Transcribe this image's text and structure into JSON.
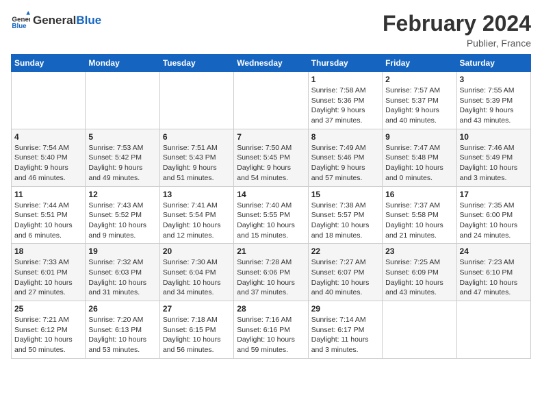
{
  "header": {
    "logo_general": "General",
    "logo_blue": "Blue",
    "month_title": "February 2024",
    "location": "Publier, France"
  },
  "days_of_week": [
    "Sunday",
    "Monday",
    "Tuesday",
    "Wednesday",
    "Thursday",
    "Friday",
    "Saturday"
  ],
  "weeks": [
    [
      {
        "day": "",
        "detail": ""
      },
      {
        "day": "",
        "detail": ""
      },
      {
        "day": "",
        "detail": ""
      },
      {
        "day": "",
        "detail": ""
      },
      {
        "day": "1",
        "detail": "Sunrise: 7:58 AM\nSunset: 5:36 PM\nDaylight: 9 hours\nand 37 minutes."
      },
      {
        "day": "2",
        "detail": "Sunrise: 7:57 AM\nSunset: 5:37 PM\nDaylight: 9 hours\nand 40 minutes."
      },
      {
        "day": "3",
        "detail": "Sunrise: 7:55 AM\nSunset: 5:39 PM\nDaylight: 9 hours\nand 43 minutes."
      }
    ],
    [
      {
        "day": "4",
        "detail": "Sunrise: 7:54 AM\nSunset: 5:40 PM\nDaylight: 9 hours\nand 46 minutes."
      },
      {
        "day": "5",
        "detail": "Sunrise: 7:53 AM\nSunset: 5:42 PM\nDaylight: 9 hours\nand 49 minutes."
      },
      {
        "day": "6",
        "detail": "Sunrise: 7:51 AM\nSunset: 5:43 PM\nDaylight: 9 hours\nand 51 minutes."
      },
      {
        "day": "7",
        "detail": "Sunrise: 7:50 AM\nSunset: 5:45 PM\nDaylight: 9 hours\nand 54 minutes."
      },
      {
        "day": "8",
        "detail": "Sunrise: 7:49 AM\nSunset: 5:46 PM\nDaylight: 9 hours\nand 57 minutes."
      },
      {
        "day": "9",
        "detail": "Sunrise: 7:47 AM\nSunset: 5:48 PM\nDaylight: 10 hours\nand 0 minutes."
      },
      {
        "day": "10",
        "detail": "Sunrise: 7:46 AM\nSunset: 5:49 PM\nDaylight: 10 hours\nand 3 minutes."
      }
    ],
    [
      {
        "day": "11",
        "detail": "Sunrise: 7:44 AM\nSunset: 5:51 PM\nDaylight: 10 hours\nand 6 minutes."
      },
      {
        "day": "12",
        "detail": "Sunrise: 7:43 AM\nSunset: 5:52 PM\nDaylight: 10 hours\nand 9 minutes."
      },
      {
        "day": "13",
        "detail": "Sunrise: 7:41 AM\nSunset: 5:54 PM\nDaylight: 10 hours\nand 12 minutes."
      },
      {
        "day": "14",
        "detail": "Sunrise: 7:40 AM\nSunset: 5:55 PM\nDaylight: 10 hours\nand 15 minutes."
      },
      {
        "day": "15",
        "detail": "Sunrise: 7:38 AM\nSunset: 5:57 PM\nDaylight: 10 hours\nand 18 minutes."
      },
      {
        "day": "16",
        "detail": "Sunrise: 7:37 AM\nSunset: 5:58 PM\nDaylight: 10 hours\nand 21 minutes."
      },
      {
        "day": "17",
        "detail": "Sunrise: 7:35 AM\nSunset: 6:00 PM\nDaylight: 10 hours\nand 24 minutes."
      }
    ],
    [
      {
        "day": "18",
        "detail": "Sunrise: 7:33 AM\nSunset: 6:01 PM\nDaylight: 10 hours\nand 27 minutes."
      },
      {
        "day": "19",
        "detail": "Sunrise: 7:32 AM\nSunset: 6:03 PM\nDaylight: 10 hours\nand 31 minutes."
      },
      {
        "day": "20",
        "detail": "Sunrise: 7:30 AM\nSunset: 6:04 PM\nDaylight: 10 hours\nand 34 minutes."
      },
      {
        "day": "21",
        "detail": "Sunrise: 7:28 AM\nSunset: 6:06 PM\nDaylight: 10 hours\nand 37 minutes."
      },
      {
        "day": "22",
        "detail": "Sunrise: 7:27 AM\nSunset: 6:07 PM\nDaylight: 10 hours\nand 40 minutes."
      },
      {
        "day": "23",
        "detail": "Sunrise: 7:25 AM\nSunset: 6:09 PM\nDaylight: 10 hours\nand 43 minutes."
      },
      {
        "day": "24",
        "detail": "Sunrise: 7:23 AM\nSunset: 6:10 PM\nDaylight: 10 hours\nand 47 minutes."
      }
    ],
    [
      {
        "day": "25",
        "detail": "Sunrise: 7:21 AM\nSunset: 6:12 PM\nDaylight: 10 hours\nand 50 minutes."
      },
      {
        "day": "26",
        "detail": "Sunrise: 7:20 AM\nSunset: 6:13 PM\nDaylight: 10 hours\nand 53 minutes."
      },
      {
        "day": "27",
        "detail": "Sunrise: 7:18 AM\nSunset: 6:15 PM\nDaylight: 10 hours\nand 56 minutes."
      },
      {
        "day": "28",
        "detail": "Sunrise: 7:16 AM\nSunset: 6:16 PM\nDaylight: 10 hours\nand 59 minutes."
      },
      {
        "day": "29",
        "detail": "Sunrise: 7:14 AM\nSunset: 6:17 PM\nDaylight: 11 hours\nand 3 minutes."
      },
      {
        "day": "",
        "detail": ""
      },
      {
        "day": "",
        "detail": ""
      }
    ]
  ]
}
